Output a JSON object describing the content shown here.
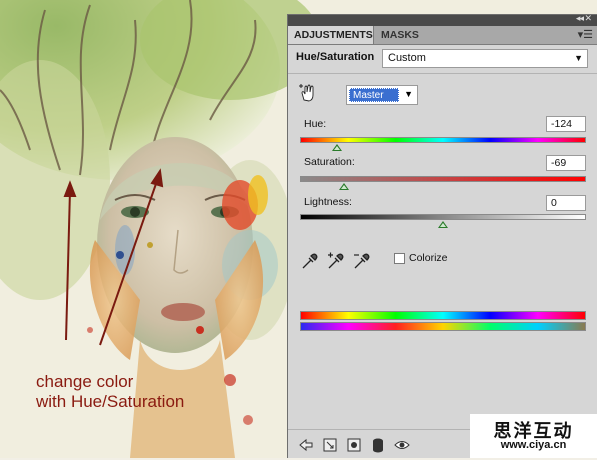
{
  "artwork": {
    "annotation_line1": "change color",
    "annotation_line2": "with Hue/Saturation"
  },
  "panel": {
    "tabs": [
      {
        "label": "ADJUSTMENTS",
        "active": true
      },
      {
        "label": "MASKS",
        "active": false
      }
    ],
    "menu_icon": "panel-menu-icon",
    "adjustment_title": "Hue/Saturation",
    "preset_value": "Custom",
    "channel_value": "Master",
    "hue": {
      "label": "Hue:",
      "value": "-124",
      "position": 0.13
    },
    "saturation": {
      "label": "Saturation:",
      "value": "-69",
      "position": 0.155
    },
    "lightness": {
      "label": "Lightness:",
      "value": "0",
      "position": 0.5
    },
    "colorize_label": "Colorize",
    "colorize_checked": false
  },
  "watermark": {
    "line1": "思洋互动",
    "line2": "www.ciya.cn"
  },
  "colors": {
    "annotation": "#8a1a10",
    "panel_bg": "#d6d6d6",
    "channel_highlight": "#3a6fd0"
  }
}
